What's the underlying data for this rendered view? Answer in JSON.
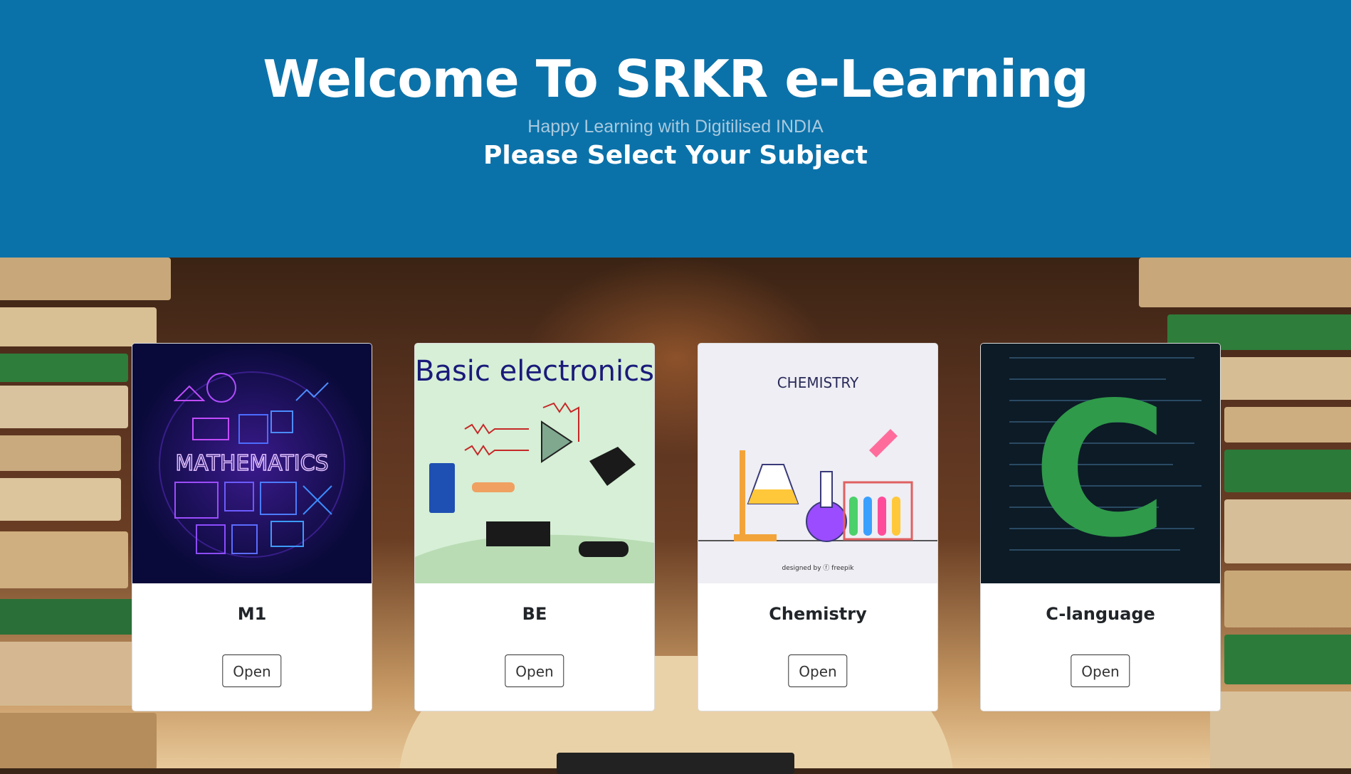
{
  "hero": {
    "title": "Welcome To SRKR e-Learning",
    "tagline": "Happy Learning with Digitilised INDIA",
    "prompt": "Please Select Your Subject"
  },
  "subjects": [
    {
      "name": "M1",
      "button": "Open",
      "image_text": "MATHEMATICS"
    },
    {
      "name": "BE",
      "button": "Open",
      "image_text": "Basic electronics"
    },
    {
      "name": "Chemistry",
      "button": "Open",
      "image_text": "CHEMISTRY",
      "credit": "designed by ⓕ freepik"
    },
    {
      "name": "C-language",
      "button": "Open",
      "image_text": "C"
    }
  ],
  "colors": {
    "hero_bg": "#0b72a9",
    "math_bg": "#0a0a3a",
    "electronics_bg": "#d6efd6",
    "chemistry_bg": "#eeeef4",
    "c_bg": "#0c1b26"
  }
}
